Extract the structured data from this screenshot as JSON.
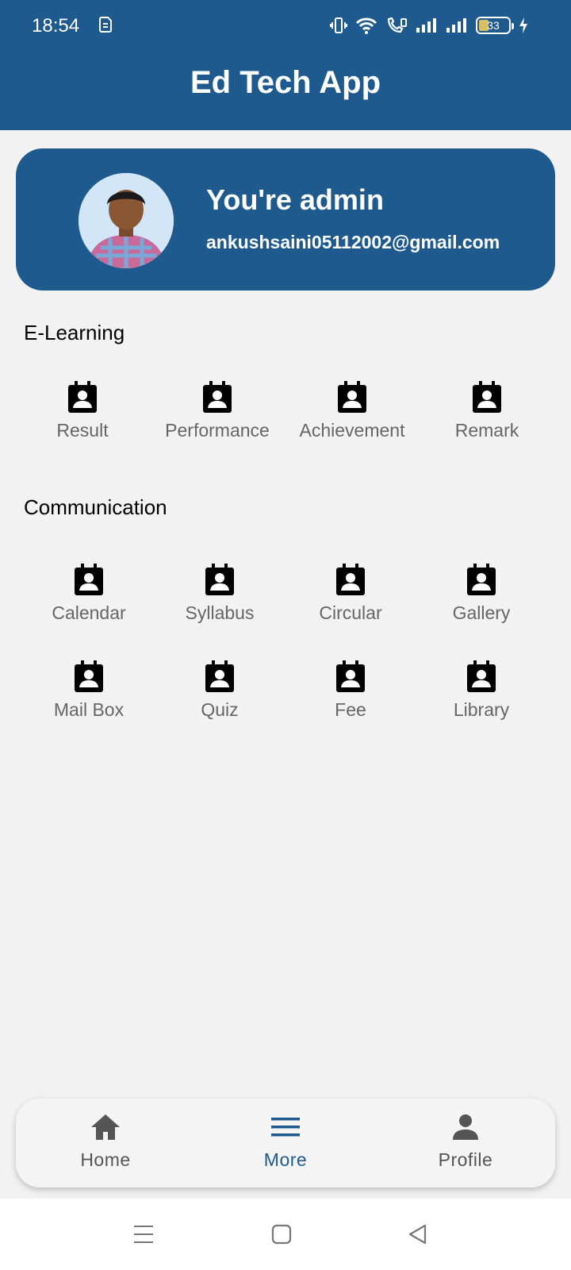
{
  "status_bar": {
    "time": "18:54",
    "battery": "33"
  },
  "header": {
    "title": "Ed Tech App"
  },
  "profile": {
    "title": "You're admin",
    "email": "ankushsaini05112002@gmail.com"
  },
  "sections": {
    "elearning": {
      "title": "E-Learning",
      "items": [
        {
          "label": "Result",
          "icon": "contact-calendar-icon"
        },
        {
          "label": "Performance",
          "icon": "contact-calendar-icon"
        },
        {
          "label": "Achievement",
          "icon": "contact-calendar-icon"
        },
        {
          "label": "Remark",
          "icon": "contact-calendar-icon"
        }
      ]
    },
    "communication": {
      "title": "Communication",
      "items": [
        {
          "label": "Calendar",
          "icon": "contact-calendar-icon"
        },
        {
          "label": "Syllabus",
          "icon": "contact-calendar-icon"
        },
        {
          "label": "Circular",
          "icon": "contact-calendar-icon"
        },
        {
          "label": "Gallery",
          "icon": "contact-calendar-icon"
        },
        {
          "label": "Mail Box",
          "icon": "contact-calendar-icon"
        },
        {
          "label": "Quiz",
          "icon": "contact-calendar-icon"
        },
        {
          "label": "Fee",
          "icon": "contact-calendar-icon"
        },
        {
          "label": "Library",
          "icon": "contact-calendar-icon"
        }
      ]
    }
  },
  "bottom_nav": {
    "items": [
      {
        "label": "Home",
        "icon": "home-icon"
      },
      {
        "label": "More",
        "icon": "menu-icon",
        "active": true
      },
      {
        "label": "Profile",
        "icon": "person-icon"
      }
    ]
  },
  "colors": {
    "primary": "#1e5a8d",
    "background": "#f2f2f2",
    "label": "#666666"
  }
}
